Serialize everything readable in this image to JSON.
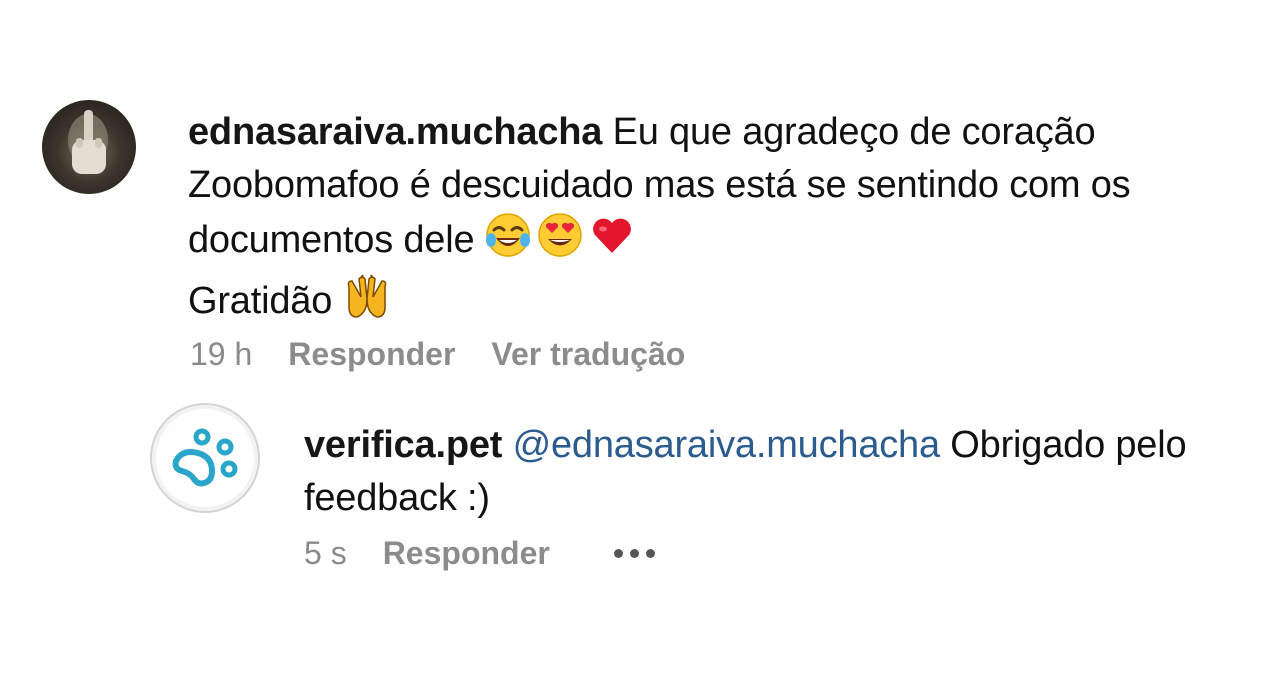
{
  "main_comment": {
    "username": "ednasaraiva.muchacha",
    "line1": "Eu que agradeço de coração",
    "line2": "Zoobomafoo é descuidado mas está se sentindo com os",
    "line3": "documentos dele",
    "line4": "Gratidão",
    "emojis_line3": [
      "tears-of-joy-emoji",
      "heart-eyes-emoji",
      "red-heart-emoji"
    ],
    "emoji_line4": "raising-hands-emoji",
    "time": "19 h",
    "reply_label": "Responder",
    "translate_label": "Ver tradução"
  },
  "reply_comment": {
    "username": "verifica.pet",
    "mention": "@ednasaraiva.muchacha",
    "text_after_mention": "Obrigado pelo",
    "line2": "feedback :)",
    "time": "5 s",
    "reply_label": "Responder",
    "more_icon": "more-options-icon",
    "logo_icon": "paw-logo-icon",
    "brand_color": "#29a6c9"
  }
}
